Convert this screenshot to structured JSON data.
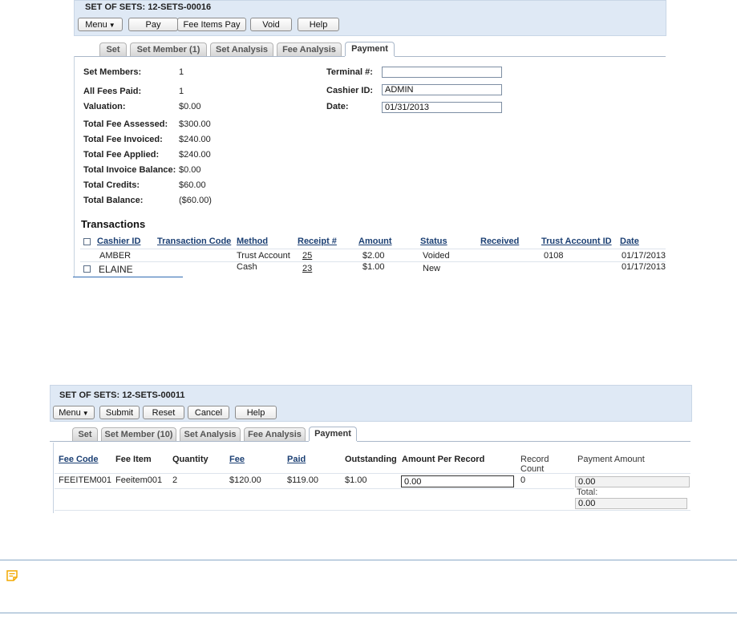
{
  "screen1": {
    "title": "SET OF SETS: 12-SETS-00016",
    "buttons": {
      "menu": "Menu",
      "pay": "Pay",
      "fee_items_pay": "Fee Items Pay",
      "void": "Void",
      "help": "Help"
    },
    "tabs": [
      "Set",
      "Set Member (1)",
      "Set Analysis",
      "Fee Analysis",
      "Payment"
    ],
    "fields": {
      "set_members": {
        "label": "Set Members:",
        "value": "1"
      },
      "all_fees_paid": {
        "label": "All Fees Paid:",
        "value": "1"
      },
      "valuation": {
        "label": "Valuation:",
        "value": "$0.00"
      },
      "total_fee_assessed": {
        "label": "Total Fee Assessed:",
        "value": "$300.00"
      },
      "total_fee_invoiced": {
        "label": "Total Fee Invoiced:",
        "value": "$240.00"
      },
      "total_fee_applied": {
        "label": "Total Fee Applied:",
        "value": "$240.00"
      },
      "total_invoice_balance": {
        "label": "Total Invoice Balance:",
        "value": "$0.00"
      },
      "total_credits": {
        "label": "Total Credits:",
        "value": "$60.00"
      },
      "total_balance": {
        "label": "Total Balance:",
        "value": "($60.00)"
      },
      "terminal": {
        "label": "Terminal #:",
        "value": ""
      },
      "cashier_id": {
        "label": "Cashier ID:",
        "value": "ADMIN"
      },
      "date": {
        "label": "Date:",
        "value": "01/31/2013"
      }
    },
    "transactions_title": "Transactions",
    "columns": [
      "Cashier ID",
      "Transaction Code",
      "Method",
      "Receipt #",
      "Amount",
      "Status",
      "Received",
      "Trust Account ID",
      "Date"
    ],
    "rows": [
      {
        "cashier_id": "AMBER",
        "method": "Trust Account",
        "receipt": "25",
        "amount": "$2.00",
        "status": "Voided",
        "trust_account_id": "0108",
        "date": "01/17/2013"
      },
      {
        "cashier_id": "ELAINE",
        "method": "Cash",
        "receipt": "23",
        "amount": "$1.00",
        "status": "New",
        "trust_account_id": "",
        "date": "01/17/2013"
      }
    ]
  },
  "screen2": {
    "title": "SET OF SETS: 12-SETS-00011",
    "buttons": {
      "menu": "Menu",
      "submit": "Submit",
      "reset": "Reset",
      "cancel": "Cancel",
      "help": "Help"
    },
    "tabs": [
      "Set",
      "Set Member (10)",
      "Set Analysis",
      "Fee Analysis",
      "Payment"
    ],
    "columns": {
      "fee_code": "Fee Code",
      "fee_item": "Fee Item",
      "quantity": "Quantity",
      "fee": "Fee",
      "paid": "Paid",
      "outstanding": "Outstanding",
      "amount_per_record": "Amount Per Record",
      "record_count_1": "Record",
      "record_count_2": "Count",
      "payment_amount": "Payment Amount"
    },
    "row": {
      "fee_code": "FEEITEM001",
      "fee_item": "Feeitem001",
      "quantity": "2",
      "fee": "$120.00",
      "paid": "$119.00",
      "outstanding": "$1.00",
      "amount_per_record": "0.00",
      "record_count": "0",
      "payment_amount": "0.00"
    },
    "total_label": "Total:",
    "total_value": "0.00"
  },
  "colors": {
    "header_bg": "#dfe9f5",
    "link": "#1b3f73",
    "note_rule": "#89a9c7",
    "note_icon": "#f2a900"
  }
}
